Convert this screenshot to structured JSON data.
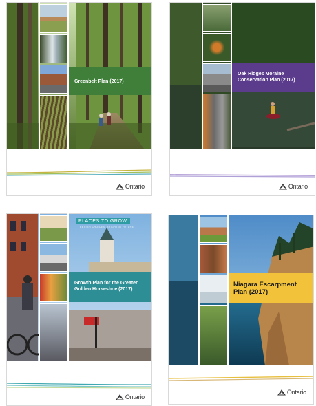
{
  "covers": [
    {
      "title": "Greenbelt Plan (2017)",
      "band_color": "#3f7f3a",
      "brand": "Ontario"
    },
    {
      "title": "Oak Ridges Moraine Conservation Plan (2017)",
      "band_color": "#5b3b8c",
      "brand": "Ontario"
    },
    {
      "title": "Growth Plan for the Greater Golden Horseshoe (2017)",
      "tag": "PLACES TO GROW",
      "tag_sub": "BETTER CHOICES. BRIGHTER FUTURE.",
      "band_color": "#2e8e95",
      "brand": "Ontario"
    },
    {
      "title": "Niagara Escarpment Plan (2017)",
      "band_color": "#f2c33a",
      "brand": "Ontario"
    }
  ],
  "icons": {
    "trillium": "trillium-icon"
  }
}
